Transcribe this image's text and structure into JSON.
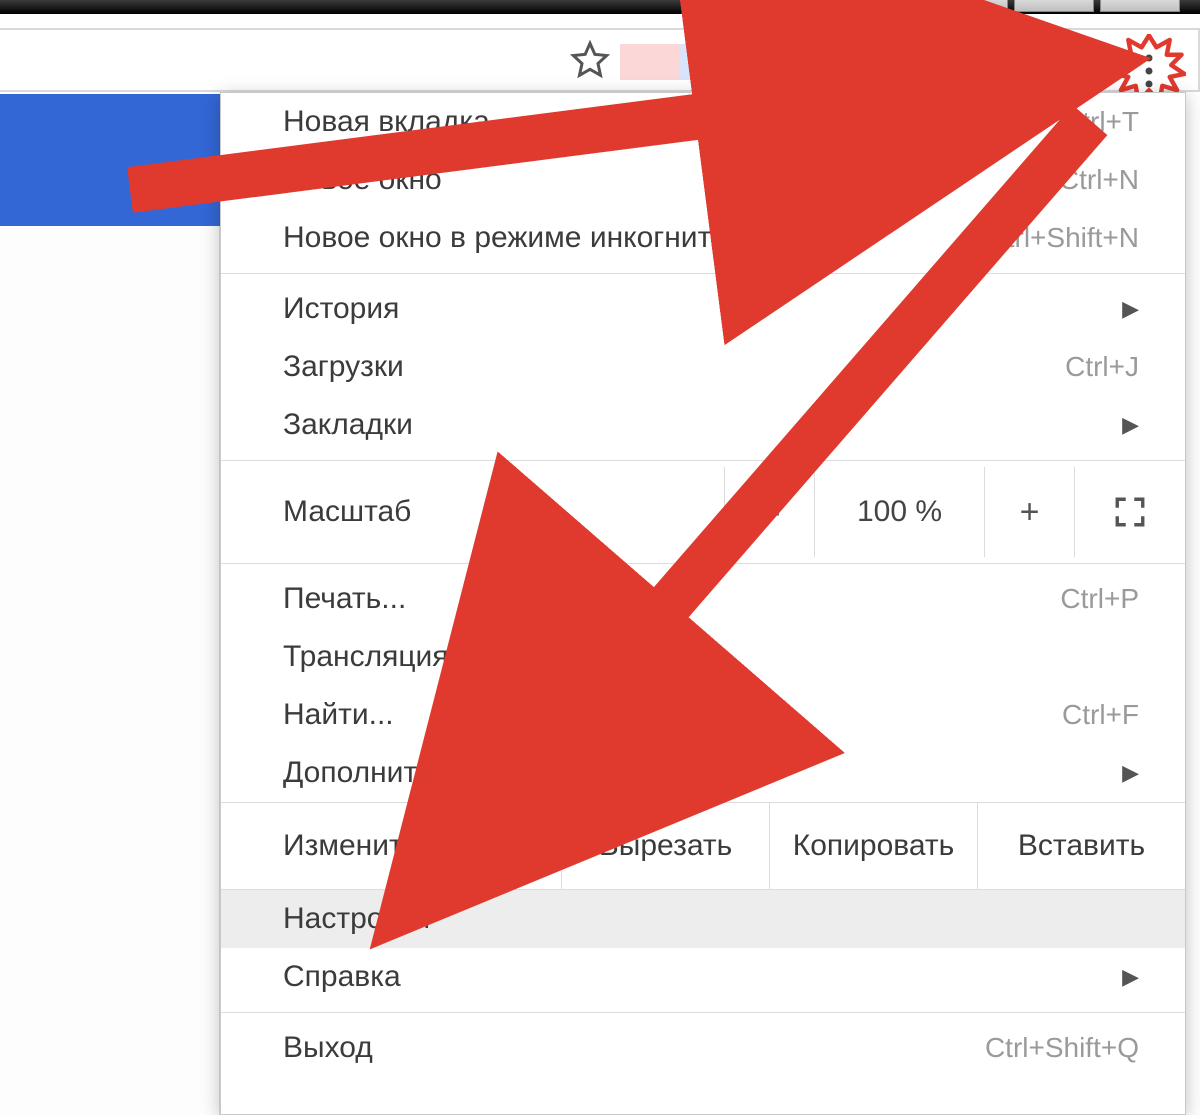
{
  "toolbar": {
    "star_icon": "star-icon",
    "kebab_icon": "kebab-menu-icon"
  },
  "menu": {
    "new_tab": {
      "label": "Новая вкладка",
      "shortcut": "Ctrl+T"
    },
    "new_window": {
      "label": "Новое окно",
      "shortcut": "Ctrl+N"
    },
    "incognito": {
      "label": "Новое окно в режиме инкогнито",
      "shortcut": "Ctrl+Shift+N"
    },
    "history": {
      "label": "История"
    },
    "downloads": {
      "label": "Загрузки",
      "shortcut": "Ctrl+J"
    },
    "bookmarks": {
      "label": "Закладки"
    },
    "zoom": {
      "label": "Масштаб",
      "value": "100 %",
      "minus": "–",
      "plus": "+"
    },
    "print": {
      "label": "Печать...",
      "shortcut": "Ctrl+P"
    },
    "cast": {
      "label": "Трансляция..."
    },
    "find": {
      "label": "Найти...",
      "shortcut": "Ctrl+F"
    },
    "more_tools": {
      "label": "Дополнительные инструменты"
    },
    "edit": {
      "label": "Изменить",
      "cut": "Вырезать",
      "copy": "Копировать",
      "paste": "Вставить"
    },
    "settings": {
      "label": "Настройки"
    },
    "help": {
      "label": "Справка"
    },
    "exit": {
      "label": "Выход",
      "shortcut": "Ctrl+Shift+Q"
    }
  }
}
